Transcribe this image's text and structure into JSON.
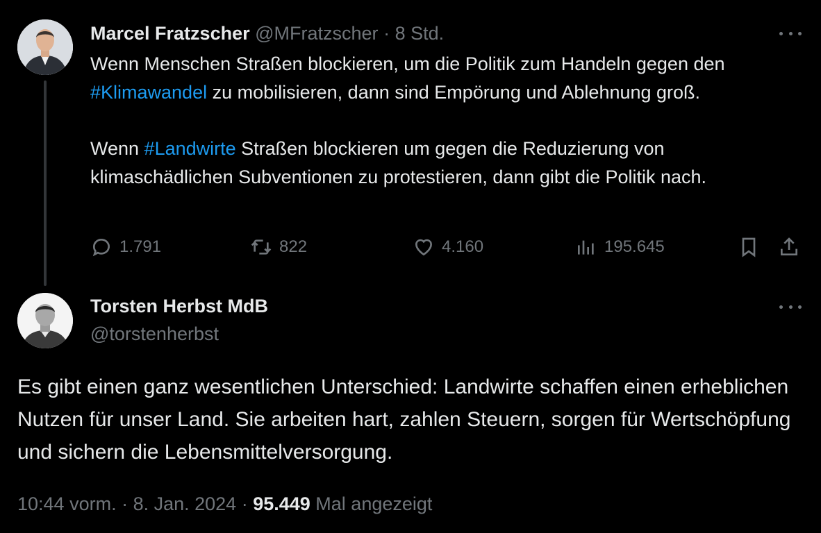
{
  "tweet1": {
    "name": "Marcel Fratzscher",
    "handle": "@MFratzscher",
    "separator": " · ",
    "time": "8 Std.",
    "text": {
      "p1_a": "Wenn Menschen Straßen blockieren, um die Politik zum Handeln gegen den ",
      "p1_tag": "#Klimawandel",
      "p1_b": " zu mobilisieren, dann sind Empörung und Ablehnung groß.",
      "p2_a": "Wenn ",
      "p2_tag": "#Landwirte",
      "p2_b": " Straßen blockieren um gegen die Reduzierung von klimaschädlichen Subventionen zu protestieren, dann gibt die Politik nach."
    },
    "actions": {
      "replies": "1.791",
      "retweets": "822",
      "likes": "4.160",
      "views": "195.645"
    }
  },
  "tweet2": {
    "name": "Torsten Herbst MdB",
    "handle": "@torstenherbst",
    "text": "Es gibt einen ganz wesentlichen Unterschied: Landwirte schaffen einen erheblichen Nutzen für unser Land. Sie arbeiten hart, zahlen Steuern, sorgen für Wertschöpfung und sichern die  Lebensmittelversorgung.",
    "time": "10:44 vorm.",
    "sep1": " · ",
    "date": "8. Jan. 2024",
    "sep2": " · ",
    "views": "95.449",
    "views_label": " Mal angezeigt"
  },
  "icons": {
    "reply": "reply-icon",
    "retweet": "retweet-icon",
    "like": "heart-icon",
    "views": "views-icon",
    "bookmark": "bookmark-icon",
    "share": "share-icon",
    "more": "more-icon"
  },
  "colors": {
    "background": "#000000",
    "text": "#e7e9ea",
    "muted": "#71767b",
    "link": "#1d9bf0"
  }
}
